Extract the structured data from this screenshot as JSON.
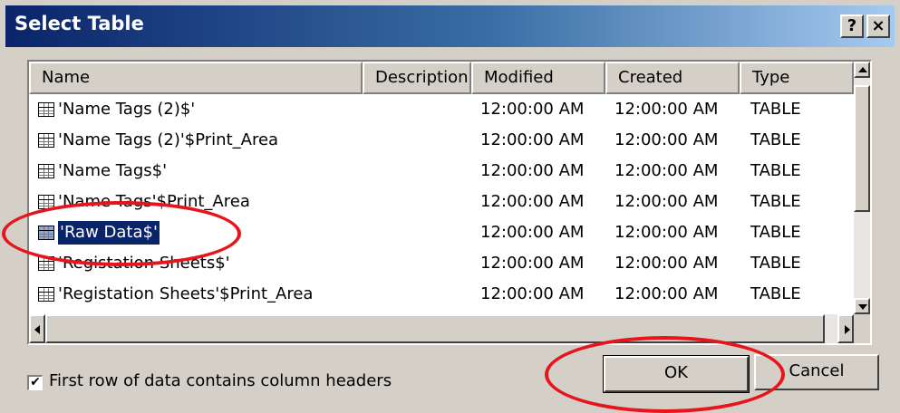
{
  "window": {
    "title": "Select Table"
  },
  "titlebar_buttons": {
    "help": "?",
    "close": "×"
  },
  "columns": [
    "Name",
    "Description",
    "Modified",
    "Created",
    "Type"
  ],
  "rows": [
    {
      "name": "'Name Tags (2)$'",
      "description": "",
      "modified": "12:00:00 AM",
      "created": "12:00:00 AM",
      "type": "TABLE"
    },
    {
      "name": "'Name Tags (2)'$Print_Area",
      "description": "",
      "modified": "12:00:00 AM",
      "created": "12:00:00 AM",
      "type": "TABLE"
    },
    {
      "name": "'Name Tags$'",
      "description": "",
      "modified": "12:00:00 AM",
      "created": "12:00:00 AM",
      "type": "TABLE"
    },
    {
      "name": "'Name Tags'$Print_Area",
      "description": "",
      "modified": "12:00:00 AM",
      "created": "12:00:00 AM",
      "type": "TABLE"
    },
    {
      "name": "'Raw Data$'",
      "description": "",
      "modified": "12:00:00 AM",
      "created": "12:00:00 AM",
      "type": "TABLE",
      "selected": true
    },
    {
      "name": "'Registation Sheets$'",
      "description": "",
      "modified": "12:00:00 AM",
      "created": "12:00:00 AM",
      "type": "TABLE"
    },
    {
      "name": "'Registation Sheets'$Print_Area",
      "description": "",
      "modified": "12:00:00 AM",
      "created": "12:00:00 AM",
      "type": "TABLE"
    }
  ],
  "checkbox": {
    "label": "First row of data contains column headers",
    "checked": true,
    "mark": "✔"
  },
  "buttons": {
    "ok": "OK",
    "cancel": "Cancel"
  },
  "colors": {
    "title_bar": "#0a246a",
    "selection": "#0a246a",
    "annotation": "#e8141b",
    "dialog_bg": "#d4d0c8"
  }
}
